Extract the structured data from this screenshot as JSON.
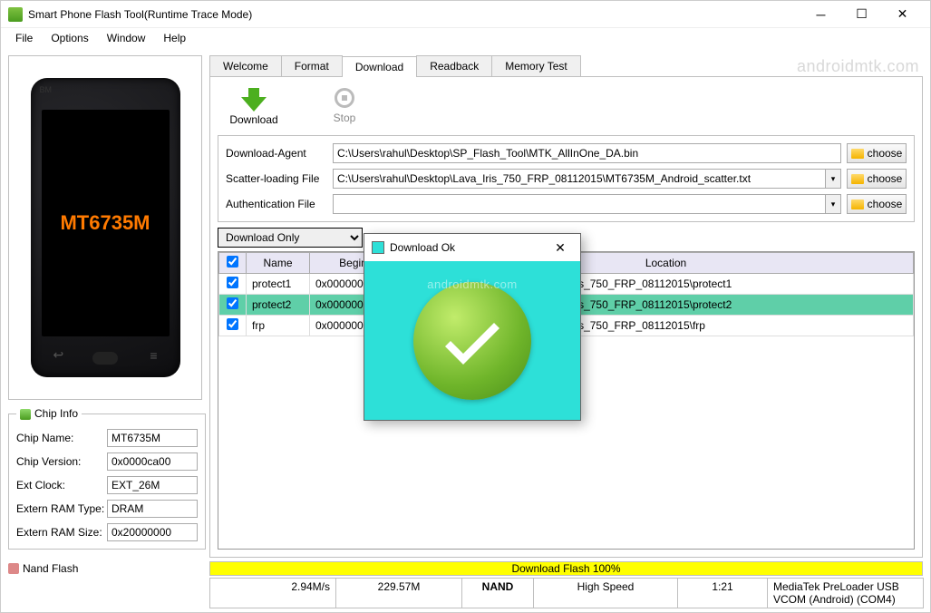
{
  "window": {
    "title": "Smart Phone Flash Tool(Runtime Trace Mode)"
  },
  "menu": {
    "file": "File",
    "options": "Options",
    "window": "Window",
    "help": "Help"
  },
  "watermark": "androidmtk.com",
  "phone": {
    "chip_text": "MT6735M",
    "bm": "BM"
  },
  "chip_info": {
    "legend": "Chip Info",
    "name_label": "Chip Name:",
    "name": "MT6735M",
    "version_label": "Chip Version:",
    "version": "0x0000ca00",
    "clock_label": "Ext Clock:",
    "clock": "EXT_26M",
    "ram_type_label": "Extern RAM Type:",
    "ram_type": "DRAM",
    "ram_size_label": "Extern RAM Size:",
    "ram_size": "0x20000000",
    "nand": "Nand Flash"
  },
  "tabs": {
    "welcome": "Welcome",
    "format": "Format",
    "download": "Download",
    "readback": "Readback",
    "memtest": "Memory Test"
  },
  "actions": {
    "download": "Download",
    "stop": "Stop"
  },
  "files": {
    "da_label": "Download-Agent",
    "da_value": "C:\\Users\\rahul\\Desktop\\SP_Flash_Tool\\MTK_AllInOne_DA.bin",
    "scatter_label": "Scatter-loading File",
    "scatter_value": "C:\\Users\\rahul\\Desktop\\Lava_Iris_750_FRP_08112015\\MT6735M_Android_scatter.txt",
    "auth_label": "Authentication File",
    "auth_value": "",
    "choose": "choose"
  },
  "mode": "Download Only",
  "grid": {
    "headers": {
      "chk": "",
      "name": "Name",
      "begin": "Begin Add",
      "loc": "Location"
    },
    "rows": [
      {
        "name": "protect1",
        "begin": "0x0000000000",
        "loc": "C:\\Users\\rahul\\Desktop\\Lava_Iris_750_FRP_08112015\\protect1"
      },
      {
        "name": "protect2",
        "begin": "0x0000000001",
        "loc": "C:\\Users\\rahul\\Desktop\\Lava_Iris_750_FRP_08112015\\protect2"
      },
      {
        "name": "frp",
        "begin": "0x0000000006",
        "loc": "C:\\Users\\rahul\\Desktop\\Lava_Iris_750_FRP_08112015\\frp"
      }
    ]
  },
  "progress": "Download Flash 100%",
  "status": {
    "speed": "2.94M/s",
    "size": "229.57M",
    "type": "NAND",
    "mode": "High Speed",
    "time": "1:21",
    "device": "MediaTek PreLoader USB VCOM (Android) (COM4)"
  },
  "dialog": {
    "title": "Download Ok"
  }
}
